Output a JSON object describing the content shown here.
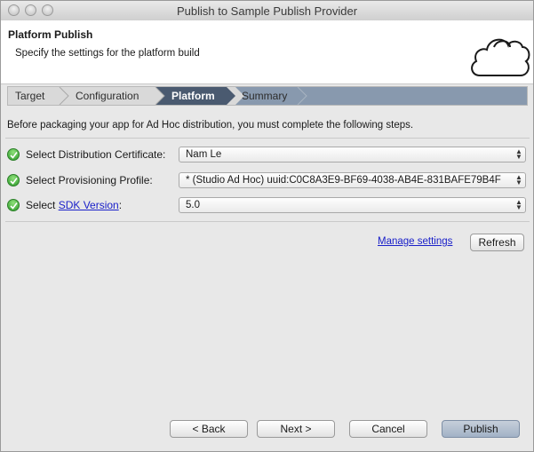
{
  "window": {
    "title": "Publish to Sample Publish Provider"
  },
  "header": {
    "title": "Platform Publish",
    "subtitle": "Specify the settings for the platform build",
    "logo_icon": "cloud-icon"
  },
  "steps": [
    {
      "label": "Target",
      "active": false
    },
    {
      "label": "Configuration",
      "active": false
    },
    {
      "label": "Platform",
      "active": true
    },
    {
      "label": "Summary",
      "active": false
    }
  ],
  "instructions": "Before packaging your app for Ad Hoc distribution, you must complete the following steps.",
  "settings": [
    {
      "label": "Select Distribution Certificate:",
      "value": "Nam Le",
      "status_icon": "check-circle-icon"
    },
    {
      "label": "Select Provisioning Profile:",
      "value": "* (Studio Ad Hoc) uuid:C0C8A3E9-BF69-4038-AB4E-831BAFE79B4F",
      "status_icon": "check-circle-icon"
    },
    {
      "label_prefix": "Select ",
      "label_link": "SDK Version",
      "label_suffix": ":",
      "value": "5.0",
      "status_icon": "check-circle-icon"
    }
  ],
  "manage_settings": "Manage settings",
  "refresh": "Refresh",
  "buttons": {
    "back": "< Back",
    "next": "Next >",
    "cancel": "Cancel",
    "publish": "Publish"
  },
  "colors": {
    "active_step": "#4a5a70",
    "link": "#1a20c9",
    "status_ok": "#2e9a2b"
  }
}
